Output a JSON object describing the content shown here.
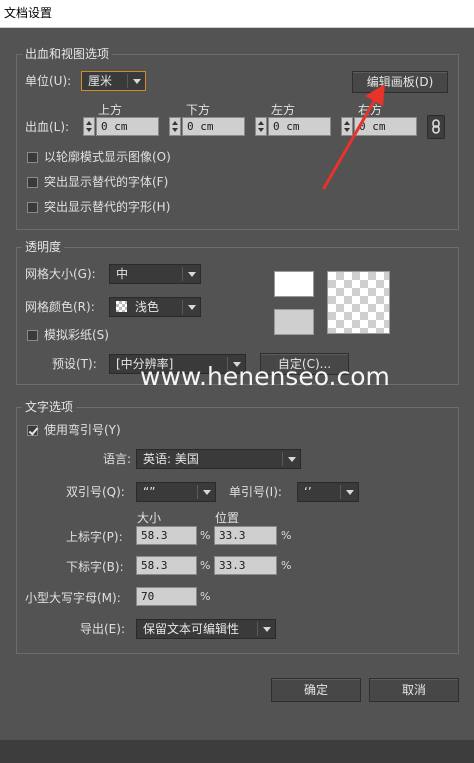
{
  "window": {
    "title": "文档设置"
  },
  "bleed_view": {
    "group_title": "出血和视图选项",
    "units_label": "单位(U):",
    "units_value": "厘米",
    "edit_artboards_button": "编辑画板(D)",
    "bleed_label": "出血(L):",
    "col_top": "上方",
    "col_bottom": "下方",
    "col_left": "左方",
    "col_right": "右方",
    "top_value": "0 cm",
    "bottom_value": "0 cm",
    "left_value": "0 cm",
    "right_value": "0 cm",
    "opt_outline": "以轮廓模式显示图像(O)",
    "opt_substituted_fonts": "突出显示替代的字体(F)",
    "opt_substituted_glyphs": "突出显示替代的字形(H)"
  },
  "transparency": {
    "group_title": "透明度",
    "grid_size_label": "网格大小(G):",
    "grid_size_value": "中",
    "grid_color_label": "网格颜色(R):",
    "grid_color_value": "浅色",
    "simulate_paper_label": "模拟彩纸(S)",
    "preset_label": "预设(T):",
    "preset_value": "[中分辨率]",
    "custom_button": "自定(C)..."
  },
  "text": {
    "group_title": "文字选项",
    "use_typographers_quotes": "使用弯引号(Y)",
    "use_typographers_quotes_checked": true,
    "language_label": "语言:",
    "language_value": "英语: 美国",
    "double_quotes_label": "双引号(Q):",
    "double_quotes_value": "“”",
    "single_quotes_label": "单引号(I):",
    "single_quotes_value": "‘’",
    "size_header": "大小",
    "position_header": "位置",
    "superscript_label": "上标字(P):",
    "superscript_size": "58.3",
    "superscript_position": "33.3",
    "subscript_label": "下标字(B):",
    "subscript_size": "58.3",
    "subscript_position": "33.3",
    "small_caps_label": "小型大写字母(M):",
    "small_caps_value": "70",
    "percent": "%",
    "export_label": "导出(E):",
    "export_value": "保留文本可编辑性"
  },
  "footer": {
    "ok_button": "确定",
    "cancel_button": "取消"
  },
  "watermark_text": "www.henenseo.com",
  "colors": {
    "dialog_bg": "#535353",
    "annotation_arrow": "#e8332a",
    "focus_outline": "#d28a2a"
  }
}
